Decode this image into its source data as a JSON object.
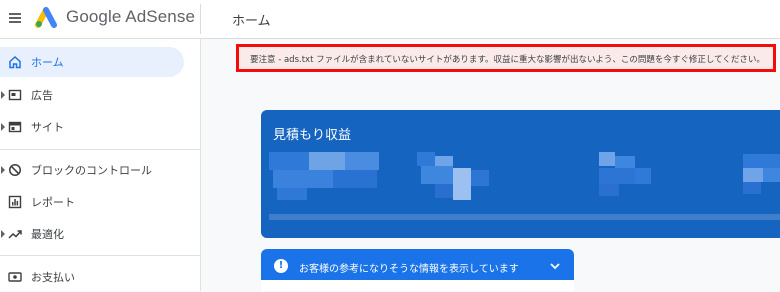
{
  "header": {
    "app_name": "Google AdSense",
    "page_title": "ホーム"
  },
  "sidebar": {
    "items": [
      {
        "label": "ホーム",
        "icon": "home-icon",
        "active": true
      },
      {
        "label": "広告",
        "icon": "ads-icon"
      },
      {
        "label": "サイト",
        "icon": "sites-icon"
      },
      {
        "label": "ブロックのコントロール",
        "icon": "block-icon"
      },
      {
        "label": "レポート",
        "icon": "report-icon"
      },
      {
        "label": "最適化",
        "icon": "optimize-icon"
      },
      {
        "label": "お支払い",
        "icon": "payments-icon"
      }
    ]
  },
  "alert": {
    "text": "要注意 - ads.txt ファイルが含まれていないサイトがあります。収益に重大な影響が出ないよう、この問題を今すぐ修正してください。",
    "border_color": "#f20c0c"
  },
  "earnings_card": {
    "title": "見積もり収益",
    "color": "#1565c0"
  },
  "info_banner": {
    "text": "お客様の参考になりそうな情報を表示しています",
    "color": "#1a73e8"
  },
  "colors": {
    "accent": "#1a73e8",
    "active_bg": "#e8f0fe"
  }
}
